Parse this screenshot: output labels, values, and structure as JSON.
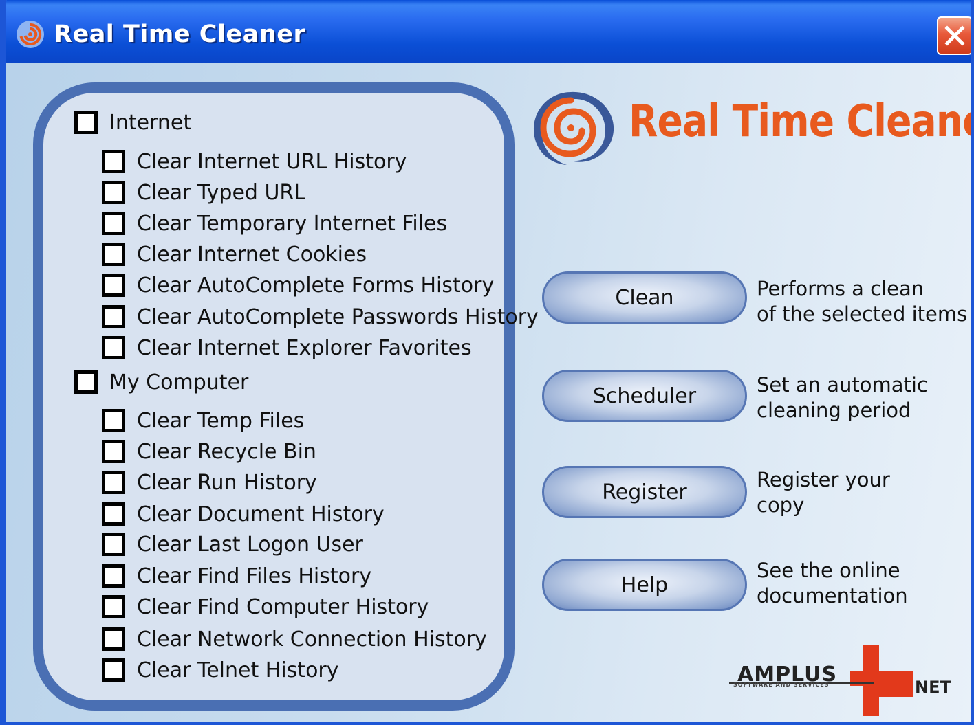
{
  "window": {
    "title": "Real Time Cleaner"
  },
  "logo": {
    "word1": "Real",
    "word2": "Time",
    "word3": "Cleaner"
  },
  "options": {
    "internet": {
      "label": "Internet",
      "checked": false,
      "items": [
        {
          "label": "Clear Internet URL History",
          "checked": false
        },
        {
          "label": "Clear Typed URL",
          "checked": false
        },
        {
          "label": "Clear Temporary Internet Files",
          "checked": false
        },
        {
          "label": "Clear Internet Cookies",
          "checked": false
        },
        {
          "label": "Clear AutoComplete Forms History",
          "checked": false
        },
        {
          "label": "Clear AutoComplete Passwords History",
          "checked": false
        },
        {
          "label": "Clear Internet Explorer Favorites",
          "checked": false
        }
      ]
    },
    "my_computer": {
      "label": "My Computer",
      "checked": false,
      "items": [
        {
          "label": "Clear Temp Files",
          "checked": false
        },
        {
          "label": "Clear Recycle Bin",
          "checked": false
        },
        {
          "label": "Clear Run History",
          "checked": false
        },
        {
          "label": "Clear Document History",
          "checked": false
        },
        {
          "label": "Clear Last Logon User",
          "checked": false
        },
        {
          "label": "Clear Find Files History",
          "checked": false
        },
        {
          "label": "Clear Find Computer History",
          "checked": false
        },
        {
          "label": "Clear Network Connection History",
          "checked": false
        },
        {
          "label": "Clear Telnet History",
          "checked": false
        }
      ]
    }
  },
  "actions": [
    {
      "label": "Clean",
      "desc_line1": "Performs a clean",
      "desc_line2": "of the selected items"
    },
    {
      "label": "Scheduler",
      "desc_line1": "Set an automatic",
      "desc_line2": "cleaning period"
    },
    {
      "label": "Register",
      "desc_line1": "Register your",
      "desc_line2": "copy"
    },
    {
      "label": "Help",
      "desc_line1": "See the online",
      "desc_line2": "documentation"
    }
  ],
  "brand": {
    "name": "AMPLUS",
    "tagline": "SOFTWARE AND SERVICES",
    "suffix": "NET"
  },
  "colors": {
    "titlebar": "#0a4fd8",
    "panel_border": "#4a6fb3",
    "logo_orange": "#e85a1e",
    "brand_red": "#e2391b"
  }
}
